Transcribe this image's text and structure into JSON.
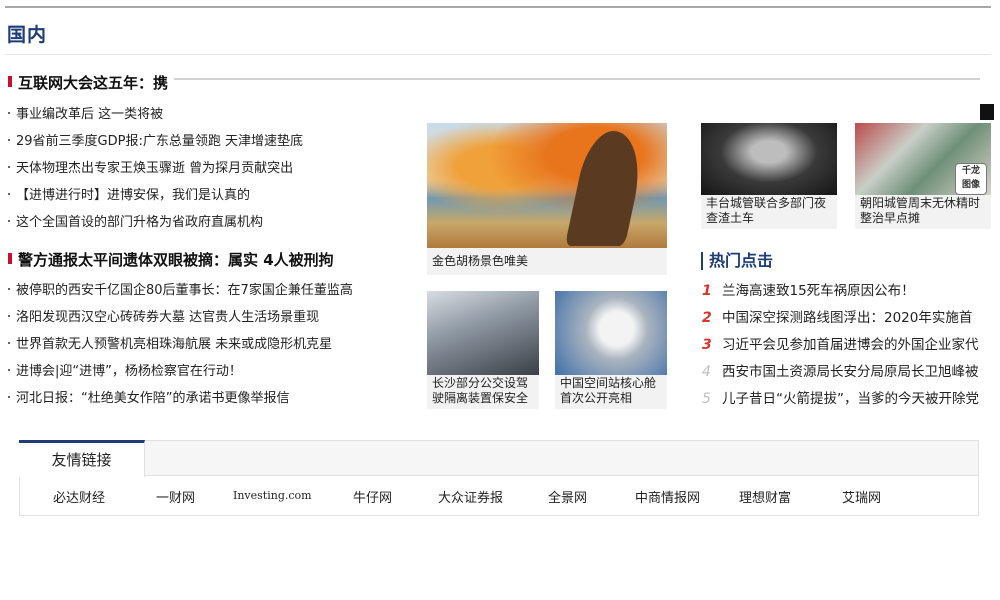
{
  "section": {
    "title": "国内"
  },
  "left": {
    "headline1": "互联网大会这五年：携",
    "list1": [
      "事业编改革后 这一类将被",
      "29省前三季度GDP报:广东总量领跑 天津增速垫底",
      "天体物理杰出专家王焕玉骤逝 曾为探月贡献突出",
      "【进博进行时】进博安保，我们是认真的",
      "这个全国首设的部门升格为省政府直属机构"
    ],
    "headline2": "警方通报太平间遗体双眼被摘：属实 4人被刑拘",
    "list2": [
      "被停职的西安千亿国企80后董事长：在7家国企兼任董监高",
      "洛阳发现西汉空心砖砖券大墓 达官贵人生活场景重现",
      "世界首款无人预警机亮相珠海航展 未来或成隐形机克星",
      "进博会|迎“进博”，杨杨检察官在行动！",
      "河北日报：“杜绝美女作陪”的承诺书更像举报信"
    ]
  },
  "photos": {
    "large": {
      "caption": "金色胡杨景色唯美",
      "icon": "autumn-poplar-photo"
    },
    "night": {
      "caption": "丰台城管联合多部门夜查渣土车",
      "icon": "night-patrol-photo"
    },
    "cart": {
      "caption": "朝阳城管周末无休精时整治早点摊",
      "icon": "food-cart-photo",
      "badge": "千龙图像"
    },
    "bus": {
      "caption": "长沙部分公交设驾驶隔离装置保安全",
      "icon": "bus-driver-photo"
    },
    "station": {
      "caption": "中国空间站核心舱首次公开亮相",
      "icon": "space-station-photo"
    }
  },
  "hot": {
    "title": "热门点击",
    "items": [
      {
        "rank": "1",
        "text": "兰海高速致15死车祸原因公布！"
      },
      {
        "rank": "2",
        "text": "中国深空探测路线图浮出：2020年实施首"
      },
      {
        "rank": "3",
        "text": "习近平会见参加首届进博会的外国企业家代"
      },
      {
        "rank": "4",
        "text": "西安市国土资源局长安分局原局长卫旭峰被"
      },
      {
        "rank": "5",
        "text": "儿子昔日“火箭提拔”，当爹的今天被开除党"
      }
    ],
    "colors": {
      "top": "#d9352b",
      "rest": "#bdbdbd"
    }
  },
  "links": {
    "tab": "友情链接",
    "items": [
      "必达财经",
      "一财网",
      "Investing.com",
      "牛仔网",
      "大众证券报",
      "全景网",
      "中商情报网",
      "理想财富",
      "艾瑞网"
    ]
  },
  "colors": {
    "accent": "#1d3c78",
    "marker": "#c8102e"
  }
}
